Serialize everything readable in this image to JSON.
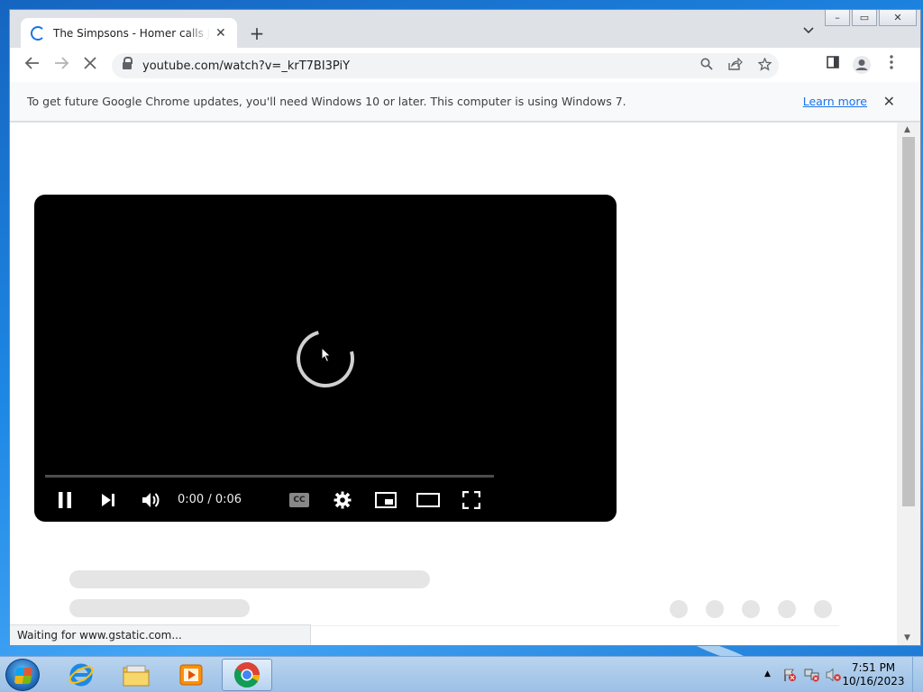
{
  "browser": {
    "tab_title": "The Simpsons - Homer calls Japan",
    "url": "youtube.com/watch?v=_krT7BI3PiY",
    "infobar_text": "To get future Google Chrome updates, you'll need Windows 10 or later. This computer is using Windows 7.",
    "infobar_link": "Learn more",
    "status_text": "Waiting for www.gstatic.com..."
  },
  "player": {
    "time": "0:00 / 0:06",
    "cc_label": "CC"
  },
  "taskbar": {
    "time": "7:51 PM",
    "date": "10/16/2023"
  },
  "colors": {
    "accent": "#1a73e8",
    "player_bg": "#000000"
  }
}
